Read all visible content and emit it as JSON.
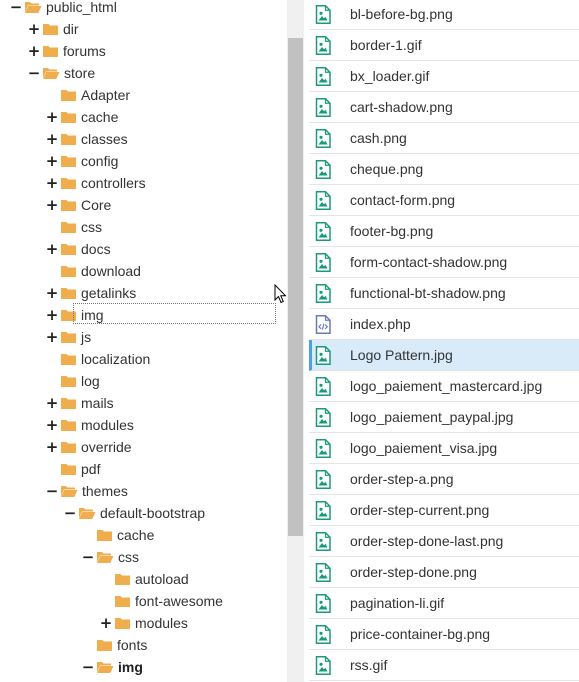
{
  "colors": {
    "folder": "#f0ad4e",
    "file_icon": "#1a9a7a",
    "php_icon": "#6c7bb8",
    "selected_bg": "#d9ebf9",
    "selected_border": "#4aa3df"
  },
  "tree": [
    {
      "label": "public_html",
      "toggle": "−",
      "open": true
    },
    {
      "label": "dir",
      "toggle": "+",
      "open": false
    },
    {
      "label": "forums",
      "toggle": "+",
      "open": false
    },
    {
      "label": "store",
      "toggle": "−",
      "open": true
    },
    {
      "label": "Adapter",
      "toggle": "",
      "open": false
    },
    {
      "label": "cache",
      "toggle": "+",
      "open": false
    },
    {
      "label": "classes",
      "toggle": "+",
      "open": false
    },
    {
      "label": "config",
      "toggle": "+",
      "open": false
    },
    {
      "label": "controllers",
      "toggle": "+",
      "open": false
    },
    {
      "label": "Core",
      "toggle": "+",
      "open": false
    },
    {
      "label": "css",
      "toggle": "",
      "open": false
    },
    {
      "label": "docs",
      "toggle": "+",
      "open": false
    },
    {
      "label": "download",
      "toggle": "",
      "open": false
    },
    {
      "label": "getalinks",
      "toggle": "+",
      "open": false
    },
    {
      "label": "img",
      "toggle": "+",
      "open": false
    },
    {
      "label": "js",
      "toggle": "+",
      "open": false
    },
    {
      "label": "localization",
      "toggle": "",
      "open": false
    },
    {
      "label": "log",
      "toggle": "",
      "open": false
    },
    {
      "label": "mails",
      "toggle": "+",
      "open": false
    },
    {
      "label": "modules",
      "toggle": "+",
      "open": false
    },
    {
      "label": "override",
      "toggle": "+",
      "open": false
    },
    {
      "label": "pdf",
      "toggle": "",
      "open": false
    },
    {
      "label": "themes",
      "toggle": "−",
      "open": true
    },
    {
      "label": "default-bootstrap",
      "toggle": "−",
      "open": true
    },
    {
      "label": "cache",
      "toggle": "",
      "open": false
    },
    {
      "label": "css",
      "toggle": "−",
      "open": true
    },
    {
      "label": "autoload",
      "toggle": "",
      "open": false
    },
    {
      "label": "font-awesome",
      "toggle": "",
      "open": false
    },
    {
      "label": "modules",
      "toggle": "+",
      "open": false
    },
    {
      "label": "fonts",
      "toggle": "",
      "open": false
    },
    {
      "label": "img",
      "toggle": "−",
      "open": true,
      "current": true
    }
  ],
  "files": [
    {
      "name": "bl-before-bg.png",
      "icon": "image-file-icon"
    },
    {
      "name": "border-1.gif",
      "icon": "image-file-icon"
    },
    {
      "name": "bx_loader.gif",
      "icon": "image-file-icon"
    },
    {
      "name": "cart-shadow.png",
      "icon": "image-file-icon"
    },
    {
      "name": "cash.png",
      "icon": "image-file-icon"
    },
    {
      "name": "cheque.png",
      "icon": "image-file-icon"
    },
    {
      "name": "contact-form.png",
      "icon": "image-file-icon"
    },
    {
      "name": "footer-bg.png",
      "icon": "image-file-icon"
    },
    {
      "name": "form-contact-shadow.png",
      "icon": "image-file-icon"
    },
    {
      "name": "functional-bt-shadow.png",
      "icon": "image-file-icon"
    },
    {
      "name": "index.php",
      "icon": "code-file-icon"
    },
    {
      "name": "Logo Pattern.jpg",
      "icon": "image-file-icon",
      "selected": true
    },
    {
      "name": "logo_paiement_mastercard.jpg",
      "icon": "image-file-icon"
    },
    {
      "name": "logo_paiement_paypal.jpg",
      "icon": "image-file-icon"
    },
    {
      "name": "logo_paiement_visa.jpg",
      "icon": "image-file-icon"
    },
    {
      "name": "order-step-a.png",
      "icon": "image-file-icon"
    },
    {
      "name": "order-step-current.png",
      "icon": "image-file-icon"
    },
    {
      "name": "order-step-done-last.png",
      "icon": "image-file-icon"
    },
    {
      "name": "order-step-done.png",
      "icon": "image-file-icon"
    },
    {
      "name": "pagination-li.gif",
      "icon": "image-file-icon"
    },
    {
      "name": "price-container-bg.png",
      "icon": "image-file-icon"
    },
    {
      "name": "rss.gif",
      "icon": "image-file-icon"
    }
  ]
}
